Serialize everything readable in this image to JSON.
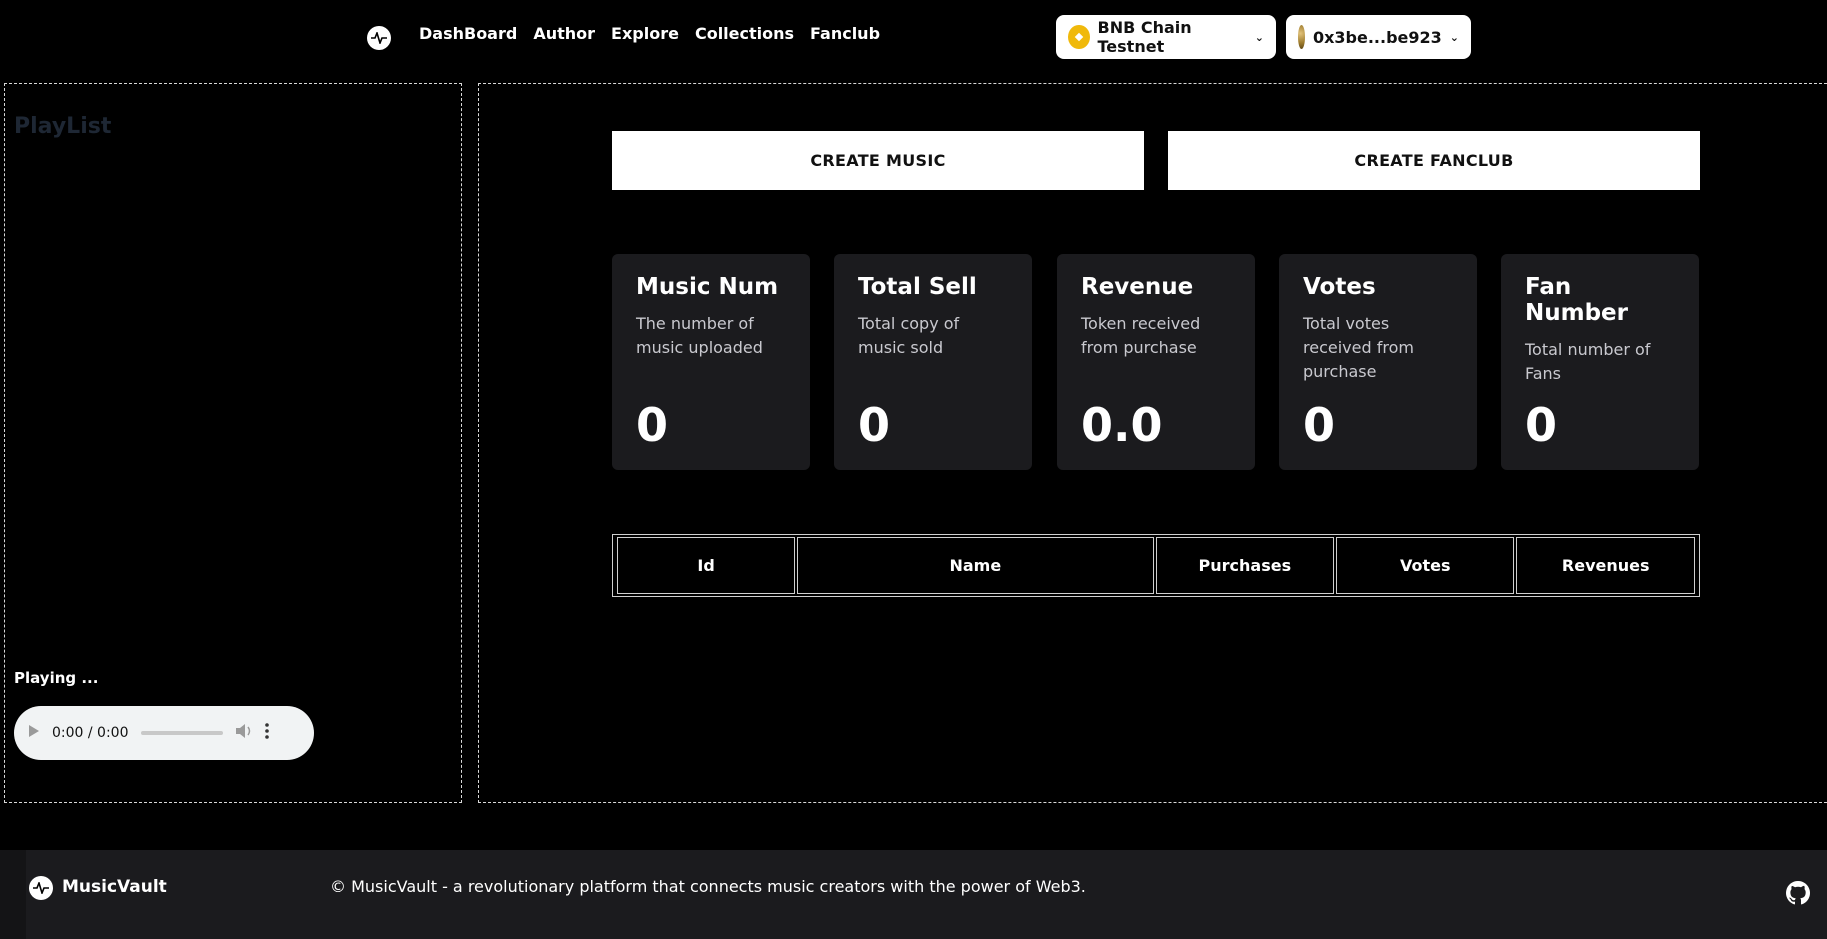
{
  "nav": {
    "links": [
      "DashBoard",
      "Author",
      "Explore",
      "Collections",
      "Fanclub"
    ]
  },
  "wallet": {
    "chain_label": "BNB Chain Testnet",
    "account_label": "0x3be...be923"
  },
  "playlist": {
    "title": "PlayList",
    "playing_label": "Playing ...",
    "player_time": "0:00 / 0:00"
  },
  "actions": {
    "create_music": "CREATE MUSIC",
    "create_fanclub": "CREATE FANCLUB"
  },
  "stats": [
    {
      "title": "Music Num",
      "desc": "The number of music uploaded",
      "value": "0"
    },
    {
      "title": "Total Sell",
      "desc": "Total copy of music sold",
      "value": "0"
    },
    {
      "title": "Revenue",
      "desc": "Token received from purchase",
      "value": "0.0"
    },
    {
      "title": "Votes",
      "desc": "Total votes received from purchase",
      "value": "0"
    },
    {
      "title": "Fan Number",
      "desc": "Total number of Fans",
      "value": "0"
    }
  ],
  "table": {
    "headers": [
      "Id",
      "Name",
      "Purchases",
      "Votes",
      "Revenues"
    ]
  },
  "footer": {
    "brand": "MusicVault",
    "copyright": "© MusicVault - a revolutionary platform that connects music creators with the power of Web3."
  },
  "colors": {
    "background": "#000000",
    "card": "#1b1b1e",
    "bnb_yellow": "#F0B90B",
    "playlist_title": "#1e2734"
  },
  "icons": [
    "pulse-logo-icon",
    "bnb-coin-icon",
    "chevron-down-icon",
    "play-icon",
    "volume-icon",
    "more-vertical-icon",
    "github-icon"
  ]
}
